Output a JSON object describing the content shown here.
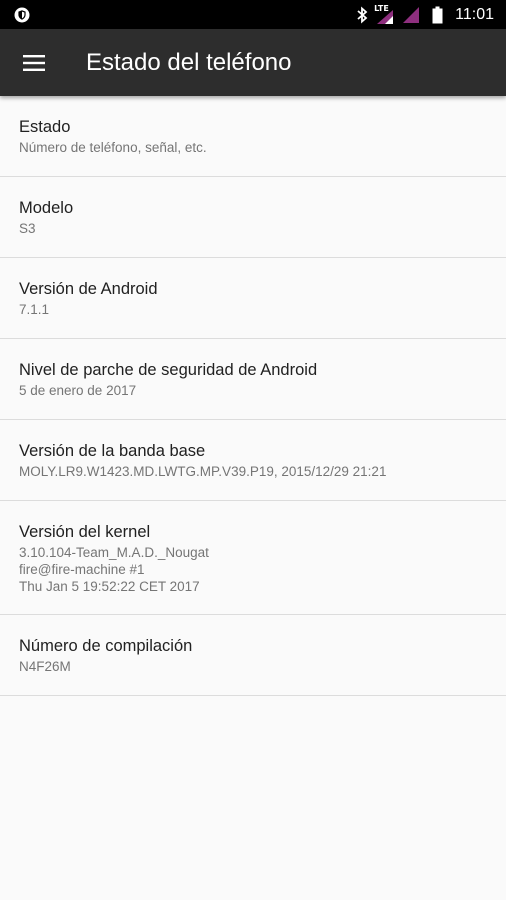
{
  "status_bar": {
    "time": "11:01",
    "network_label": "LTE",
    "left_icon": "shield-icon",
    "icons": [
      "bluetooth-icon",
      "lte-signal-icon",
      "signal-icon",
      "battery-icon"
    ]
  },
  "app_bar": {
    "title": "Estado del teléfono",
    "menu_icon": "menu-icon"
  },
  "items": [
    {
      "title": "Estado",
      "summary": "Número de teléfono, señal, etc."
    },
    {
      "title": "Modelo",
      "summary": "S3"
    },
    {
      "title": "Versión de Android",
      "summary": "7.1.1"
    },
    {
      "title": "Nivel de parche de seguridad de Android",
      "summary": "5 de enero de 2017"
    },
    {
      "title": "Versión de la banda base",
      "summary": "MOLY.LR9.W1423.MD.LWTG.MP.V39.P19, 2015/12/29 21:21"
    },
    {
      "title": "Versión del kernel",
      "summary": "3.10.104-Team_M.A.D._Nougat\nfire@fire-machine #1\nThu Jan 5 19:52:22 CET 2017"
    },
    {
      "title": "Número de compilación",
      "summary": "N4F26M"
    }
  ],
  "colors": {
    "status_bar": "#000000",
    "app_bar": "#2d2d2d",
    "background": "#fafafa",
    "signal_accent": "#8e2f7e"
  }
}
